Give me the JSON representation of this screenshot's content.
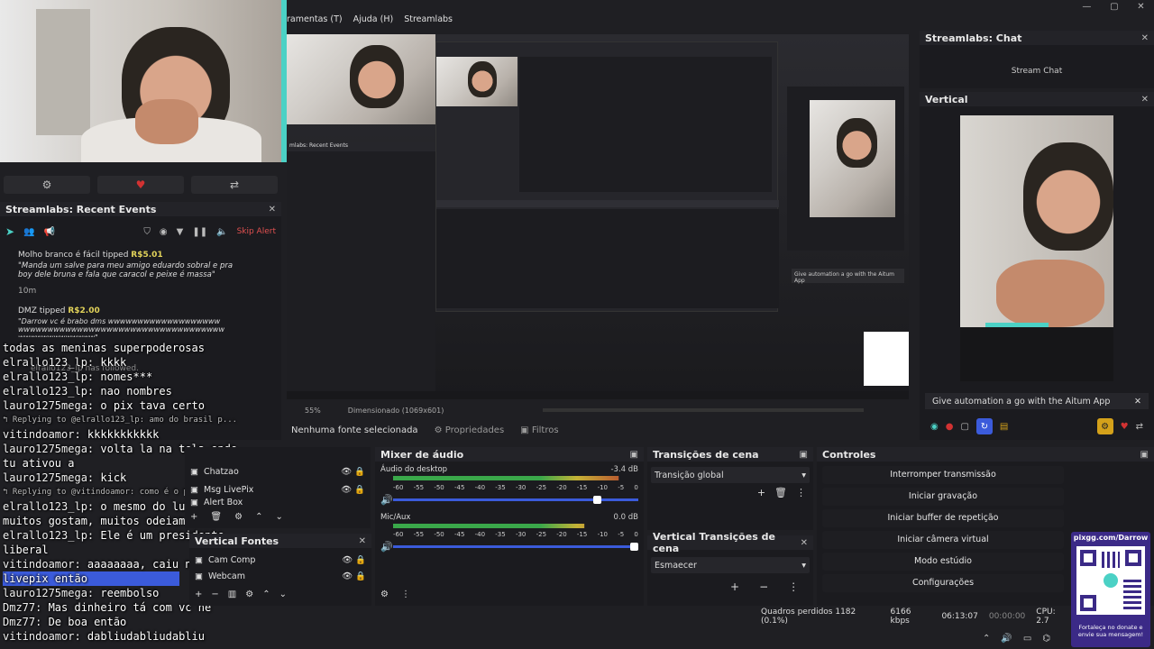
{
  "menu": {
    "items": [
      "ramentas (T)",
      "Ajuda (H)",
      "Streamlabs"
    ]
  },
  "window_controls": {
    "minimize": "—",
    "maximize": "▢",
    "close": "✕"
  },
  "preview_toolbar": {
    "settings_icon": "gear-icon",
    "heart_icon": "heart-icon",
    "switch_icon": "switch-icon"
  },
  "recent_events": {
    "title": "Streamlabs: Recent Events",
    "skip_alert": "Skip Alert",
    "events": [
      {
        "name": "Molho branco é fácil",
        "tipped": "tipped",
        "amount": "R$5.01",
        "message": "\"Manda um salve para meu amigo eduardo sobral e pra boy dele bruna e fala que caracol e peixe é massa\"",
        "time": "10m"
      },
      {
        "name": "DMZ",
        "tipped": "tipped",
        "amount": "R$2.00",
        "message": "\"Darrow vc é brabo dms wwwwwwwwwwwwwwwwwwwwwwwwwwwwwwwwwwwwwwwwwwwwwwwwwwwwwwwwwwwwwwwwwww\"",
        "time": ""
      }
    ],
    "followed": "elrallo123_lp has followed."
  },
  "chat_overlay": {
    "lines": [
      {
        "user": "",
        "text": "todas as meninas superpoderosas"
      },
      {
        "user": "elrallo123_lp:",
        "text": " kkkk"
      },
      {
        "user": "elrallo123_lp:",
        "text": " nomes***"
      },
      {
        "user": "elrallo123_lp:",
        "text": " nao nombres"
      },
      {
        "user": "lauro1275mega:",
        "text": " o pix tava certo"
      },
      {
        "user": "",
        "text": "↰ Replying to @elrallo123_lp: amo do brasil p..."
      },
      {
        "user": "vitindoamor:",
        "text": " kkkkkkkkkkk"
      },
      {
        "user": "lauro1275mega:",
        "text": " volta la na tela onde"
      },
      {
        "user": "",
        "text": "tu ativou a"
      },
      {
        "user": "lauro1275mega:",
        "text": " kick"
      },
      {
        "user": "",
        "text": "↰ Replying to @vitindoamor: como é o presidente"
      },
      {
        "user": "elrallo123_lp:",
        "text": " o mesmo do lula,"
      },
      {
        "user": "",
        "text": "muitos gostam, muitos odeiam"
      },
      {
        "user": "elrallo123_lp:",
        "text": " Ele é um presidente"
      },
      {
        "user": "",
        "text": "liberal"
      },
      {
        "user": "vitindoamor:",
        "text": " aaaaaaaa, caiu na do"
      },
      {
        "user": "",
        "text": "livepix então"
      },
      {
        "user": "lauro1275mega:",
        "text": " reembolso"
      },
      {
        "user": "Dmz77:",
        "text": " Mas dinheiro tá com vc né"
      },
      {
        "user": "Dmz77:",
        "text": " De boa então"
      },
      {
        "user": "vitindoamor:",
        "text": " dabliudabliudabliu"
      }
    ]
  },
  "canvas_bar": {
    "zoom": "55%",
    "dimensions": "Dimensionado (1069x601)",
    "no_source": "Nenhuma fonte selecionada",
    "properties": "Propriedades",
    "filters": "Filtros"
  },
  "chat_dock": {
    "title": "Streamlabs: Chat",
    "stream_chat": "Stream Chat"
  },
  "vertical_dock": {
    "title": "Vertical",
    "aitum_text": "Give automation a go with the Aitum App",
    "close": "✕"
  },
  "sources": {
    "items": [
      "Chatzao",
      "Msg LivePix",
      "Alert Box"
    ]
  },
  "vertical_sources": {
    "title": "Vertical Fontes",
    "items": [
      "Cam Comp",
      "Webcam"
    ]
  },
  "mixer": {
    "title": "Mixer de áudio",
    "channels": [
      {
        "name": "Áudio do desktop",
        "db": "-3.4 dB",
        "level": 0.92,
        "volume": 0.85
      },
      {
        "name": "Mic/Aux",
        "db": "0.0 dB",
        "level": 0.78,
        "volume": 1.0
      }
    ],
    "ticks": [
      "-60",
      "-55",
      "-50",
      "-45",
      "-40",
      "-35",
      "-30",
      "-25",
      "-20",
      "-15",
      "-10",
      "-5",
      "0"
    ]
  },
  "transitions": {
    "title": "Transições de cena",
    "value": "Transição global"
  },
  "vertical_transitions": {
    "title": "Vertical Transições de cena",
    "value": "Esmaecer"
  },
  "controls": {
    "title": "Controles",
    "buttons": [
      "Interromper transmissão",
      "Iniciar gravação",
      "Iniciar buffer de repetição",
      "Iniciar câmera virtual",
      "Modo estúdio",
      "Configurações"
    ]
  },
  "status_bar": {
    "dropped": "Quadros perdidos 1182 (0.1%)",
    "bitrate": "6166 kbps",
    "stream_time": "06:13:07",
    "rec_time": "00:00:00",
    "cpu": "CPU: 2.7"
  },
  "pixgg": {
    "url": "pixgg.com/Darrow",
    "caption": "Fortaleça no donate e envie sua mensagem!"
  },
  "colors": {
    "accent": "#3b5bdb",
    "record_red": "#d23232",
    "gold": "#d4a11a",
    "teal": "#4bd1c5"
  }
}
